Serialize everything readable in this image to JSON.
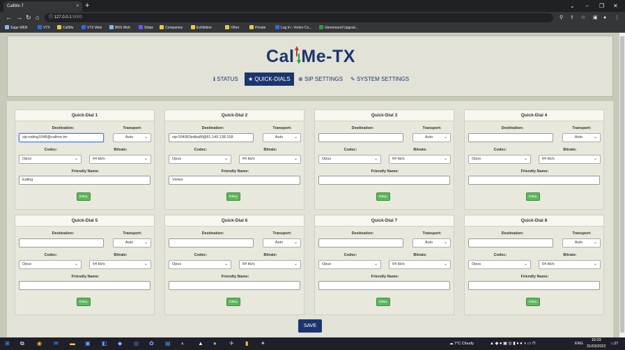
{
  "browser": {
    "tab_title": "CallMe-T",
    "tab_close": "×",
    "new_tab": "+",
    "url_host": "127.0.0.1",
    "url_port": ":5000",
    "window_controls": [
      "⌄",
      "−",
      "❐",
      "✕"
    ],
    "bookmarks": [
      {
        "label": "Sage WEB",
        "color": "#8ab4f8"
      },
      {
        "label": "VTX",
        "color": "#2e6bd6"
      },
      {
        "label": "CallMe",
        "color": "#f5c542"
      },
      {
        "label": "VTX Web",
        "color": "#2e6bd6"
      },
      {
        "label": "BRS Web",
        "color": "#8ab4f8"
      },
      {
        "label": "Stripe",
        "color": "#635bff"
      },
      {
        "label": "Companies",
        "color": "#f5c542"
      },
      {
        "label": "Exhibition",
        "color": "#f5c542"
      },
      {
        "label": "Other",
        "color": "#f5c542"
      },
      {
        "label": "Private",
        "color": "#f5c542"
      },
      {
        "label": "Log In ‹ Vortex Co...",
        "color": "#2e6bd6"
      },
      {
        "label": "Glenmound Upgrad...",
        "color": "#2e9c3a"
      }
    ]
  },
  "app": {
    "logo": {
      "part1": "Cal",
      "part2": "Me-TX"
    },
    "nav": [
      {
        "label": "STATUS",
        "icon": "info-icon",
        "glyph": "ℹ"
      },
      {
        "label": "QUICK-DIALS",
        "icon": "star-icon",
        "glyph": "★"
      },
      {
        "label": "SIP SETTINGS",
        "icon": "globe-icon",
        "glyph": "⊕"
      },
      {
        "label": "SYSTEM SETTINGS",
        "icon": "wrench-icon",
        "glyph": "✎"
      }
    ],
    "labels": {
      "destination": "Destination:",
      "transport": "Transport:",
      "codec": "Codec:",
      "bitrate": "Bitrate:",
      "friendly_name": "Friendly Name:",
      "call": "CALL"
    },
    "quick_dials": [
      {
        "title": "Quick-Dial 1",
        "destination": "sip:ealing1048@callme.tm",
        "transport": "Auto",
        "codec": "Opus",
        "bitrate": "64 kb/s",
        "friendly_name": "Ealing"
      },
      {
        "title": "Quick-Dial 2",
        "destination": "sip:004063edba8f@81.149.138.158",
        "transport": "Auto",
        "codec": "Opus",
        "bitrate": "64 kb/s",
        "friendly_name": "Vortex"
      },
      {
        "title": "Quick-Dial 3",
        "destination": "",
        "transport": "Auto",
        "codec": "Opus",
        "bitrate": "64 kb/s",
        "friendly_name": ""
      },
      {
        "title": "Quick-Dial 4",
        "destination": "",
        "transport": "Auto",
        "codec": "Opus",
        "bitrate": "64 kb/s",
        "friendly_name": ""
      },
      {
        "title": "Quick-Dial 5",
        "destination": "",
        "transport": "Auto",
        "codec": "Opus",
        "bitrate": "64 kb/s",
        "friendly_name": ""
      },
      {
        "title": "Quick-Dial 6",
        "destination": "",
        "transport": "Auto",
        "codec": "Opus",
        "bitrate": "64 kb/s",
        "friendly_name": ""
      },
      {
        "title": "Quick-Dial 7",
        "destination": "",
        "transport": "Auto",
        "codec": "Opus",
        "bitrate": "64 kb/s",
        "friendly_name": ""
      },
      {
        "title": "Quick-Dial 8",
        "destination": "",
        "transport": "Auto",
        "codec": "Opus",
        "bitrate": "64 kb/s",
        "friendly_name": ""
      }
    ],
    "save_label": "SAVE"
  },
  "taskbar": {
    "weather": "7°C Cloudy",
    "language": "ENG",
    "time": "16:03",
    "date": "31/03/2022",
    "notifications": "27"
  }
}
